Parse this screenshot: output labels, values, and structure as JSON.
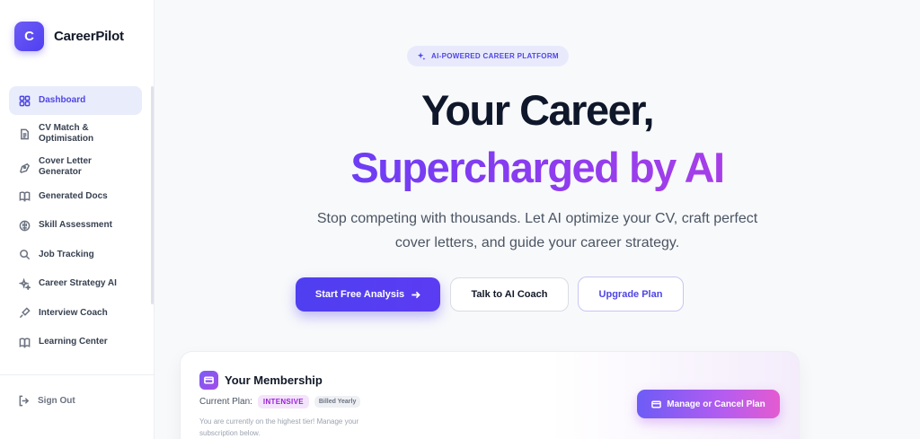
{
  "brand": {
    "logo_letter": "C",
    "name": "CareerPilot",
    "accent": "#4f46e5"
  },
  "sidebar": {
    "items": [
      {
        "label": "Dashboard",
        "icon": "dashboard-grid-icon",
        "active": true
      },
      {
        "label": "CV Match & Optimisation",
        "icon": "document-icon",
        "active": false
      },
      {
        "label": "Cover Letter Generator",
        "icon": "pen-nib-icon",
        "active": false
      },
      {
        "label": "Generated Docs",
        "icon": "book-open-icon",
        "active": false
      },
      {
        "label": "Skill Assessment",
        "icon": "brain-icon",
        "active": false
      },
      {
        "label": "Job Tracking",
        "icon": "search-icon",
        "active": false
      },
      {
        "label": "Career Strategy AI",
        "icon": "sparkles-icon",
        "active": false
      },
      {
        "label": "Interview Coach",
        "icon": "microphone-icon",
        "active": false
      },
      {
        "label": "Learning Center",
        "icon": "book-open-icon",
        "active": false
      }
    ],
    "sign_out": "Sign Out"
  },
  "hero": {
    "badge": "AI-POWERED CAREER PLATFORM",
    "title_line1": "Your Career,",
    "title_line2": "Supercharged by AI",
    "subtitle_line1": "Stop competing with thousands. Let AI optimize your CV, craft perfect",
    "subtitle_line2": "cover letters, and guide your career strategy.",
    "primary_button": "Start Free Analysis",
    "secondary_button": "Talk to AI Coach",
    "upgrade_button": "Upgrade Plan"
  },
  "membership": {
    "title": "Your Membership",
    "current_plan_label": "Current Plan:",
    "plan_name": "INTENSIVE",
    "billing": "Billed Yearly",
    "note": "You are currently on the highest tier! Manage your subscription below.",
    "manage_button": "Manage or Cancel Plan"
  }
}
